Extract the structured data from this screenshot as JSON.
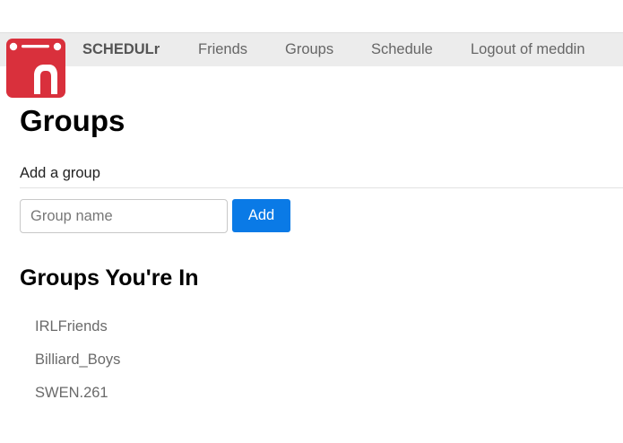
{
  "navbar": {
    "brand": "SCHEDULr",
    "links": [
      "Friends",
      "Groups",
      "Schedule",
      "Logout of meddin"
    ]
  },
  "logo": {
    "icon": "calendar-r-icon",
    "color": "#d9303c"
  },
  "page": {
    "title": "Groups"
  },
  "add_group": {
    "label": "Add a group",
    "input_placeholder": "Group name",
    "input_value": "",
    "button_label": "Add",
    "button_color": "#0a7ae6"
  },
  "groups_section": {
    "heading": "Groups You're In",
    "groups": [
      "IRLFriends",
      "Billiard_Boys",
      "SWEN.261"
    ]
  }
}
